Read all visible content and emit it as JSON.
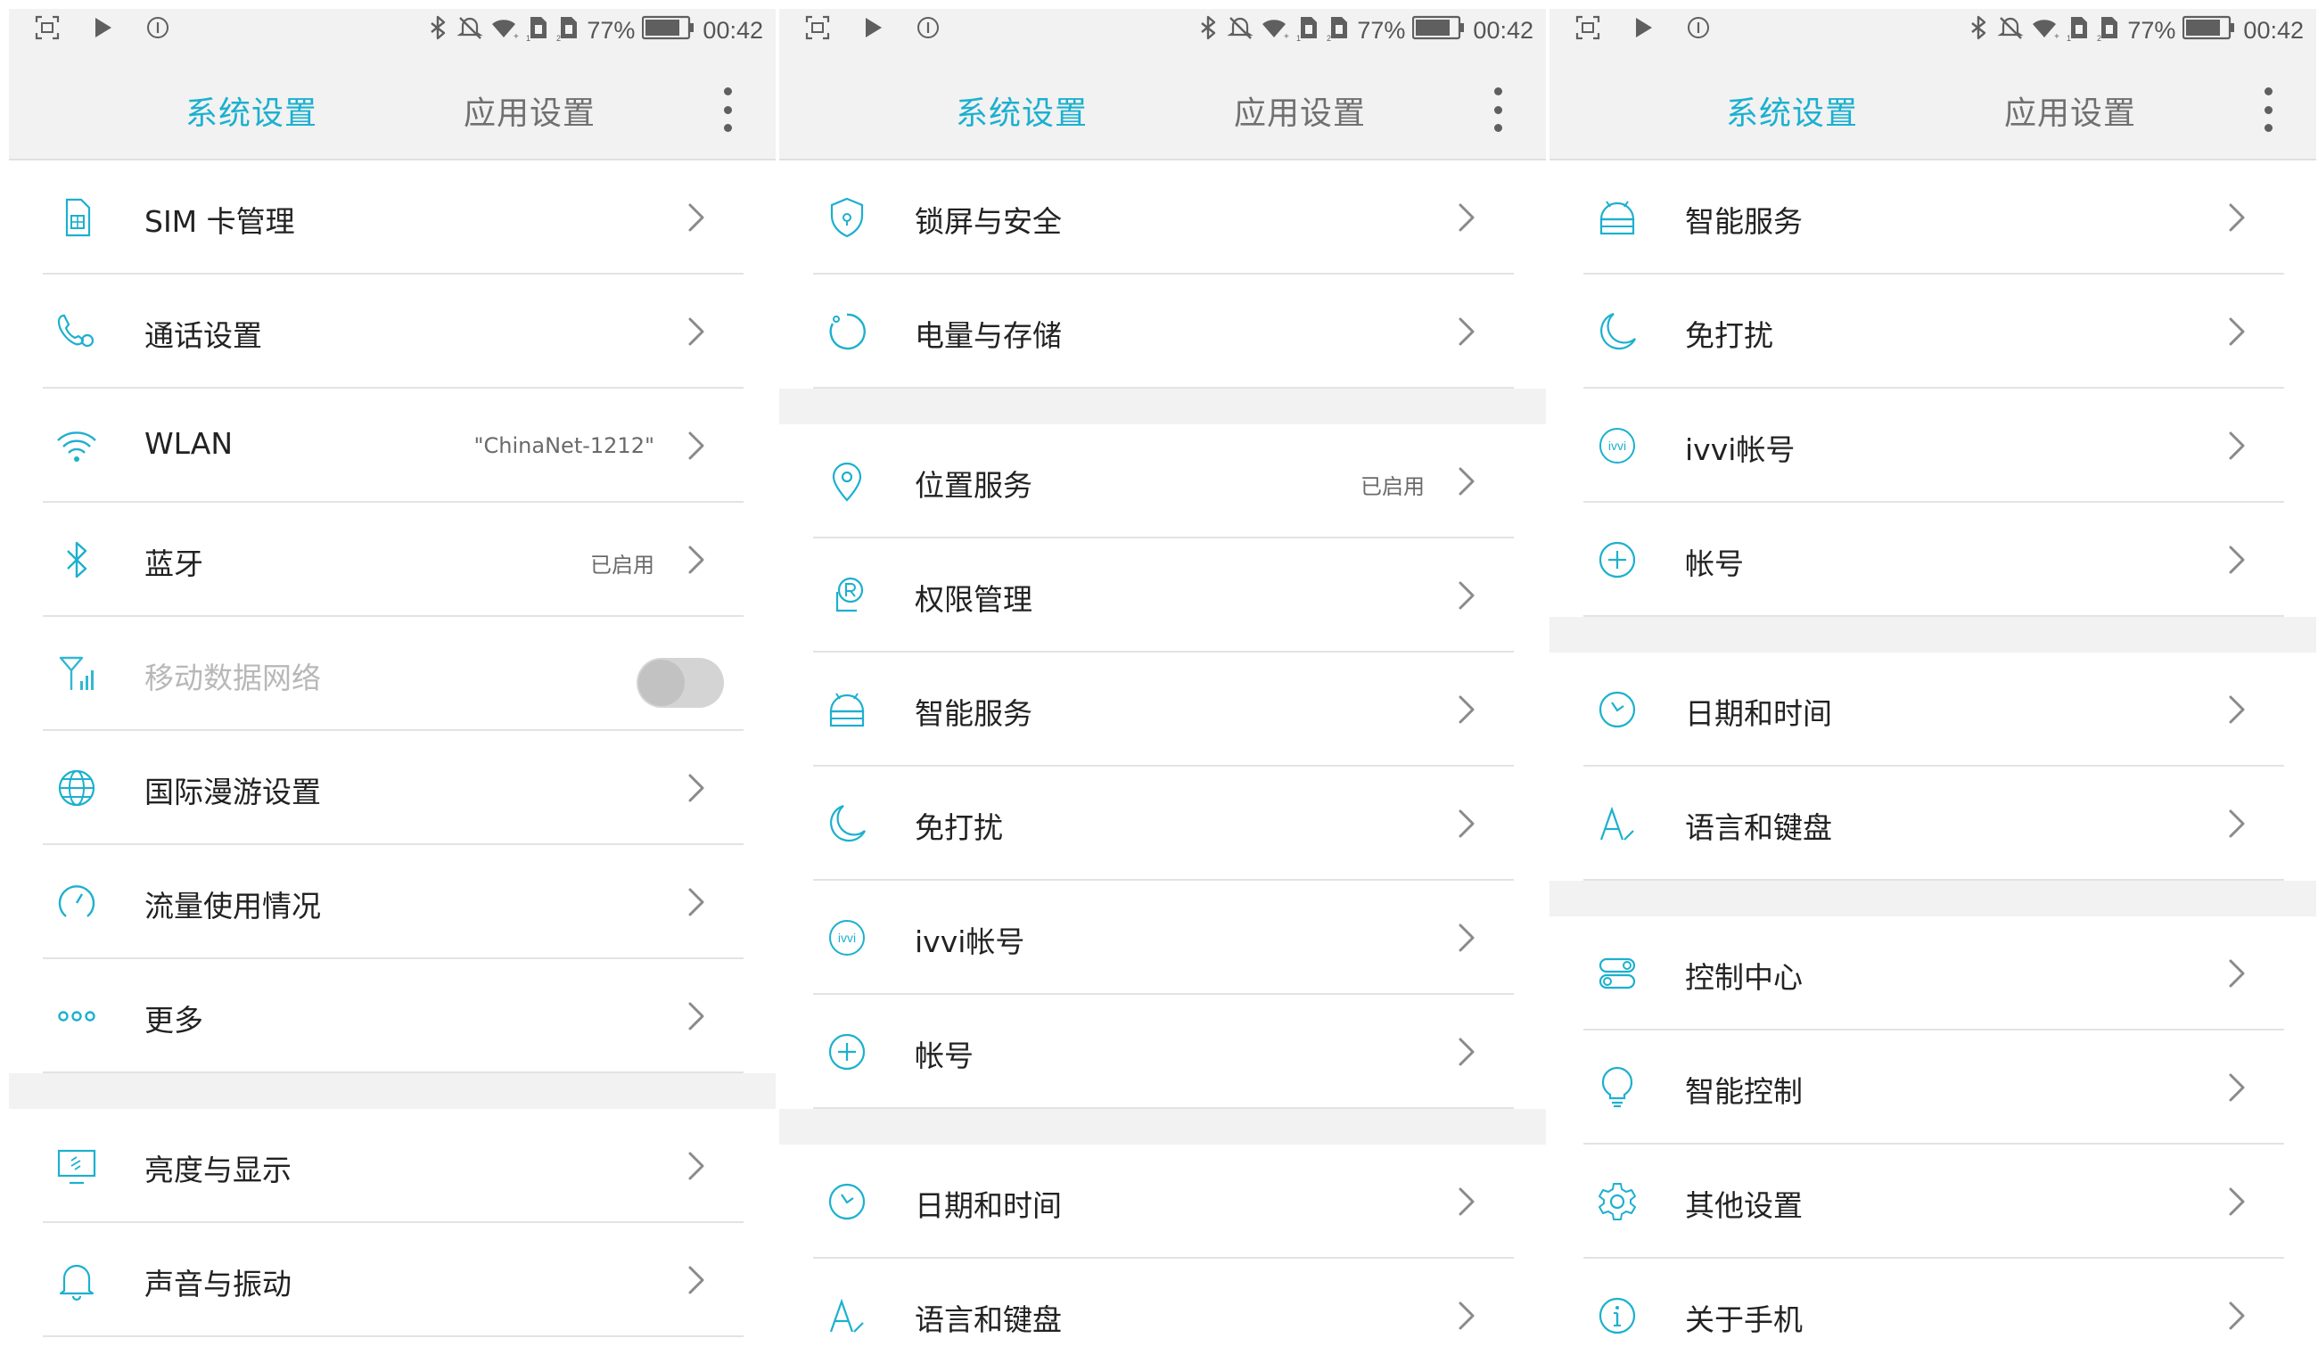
{
  "panels": [
    {
      "status": {
        "battery": "77%",
        "time": "00:42"
      },
      "tabs": {
        "system": "系统设置",
        "apps": "应用设置"
      },
      "sections": [
        [
          {
            "icon": "sim-card-icon",
            "label": "SIM 卡管理"
          },
          {
            "icon": "call-icon",
            "label": "通话设置"
          },
          {
            "icon": "wifi-icon",
            "label": "WLAN",
            "value": "\"ChinaNet-1212\""
          },
          {
            "icon": "bluetooth-icon",
            "label": "蓝牙",
            "value": "已启用"
          },
          {
            "icon": "mobile-data-icon",
            "label": "移动数据网络",
            "toggle": false,
            "disabled": true
          },
          {
            "icon": "globe-icon",
            "label": "国际漫游设置"
          },
          {
            "icon": "data-usage-icon",
            "label": "流量使用情况"
          },
          {
            "icon": "more-icon",
            "label": "更多"
          }
        ],
        [
          {
            "icon": "display-icon",
            "label": "亮度与显示"
          },
          {
            "icon": "bell-icon",
            "label": "声音与振动"
          }
        ]
      ]
    },
    {
      "status": {
        "battery": "77%",
        "time": "00:42"
      },
      "tabs": {
        "system": "系统设置",
        "apps": "应用设置"
      },
      "sections": [
        [
          {
            "icon": "shield-icon",
            "label": "锁屏与安全"
          },
          {
            "icon": "battery-storage-icon",
            "label": "电量与存储"
          }
        ],
        [
          {
            "icon": "location-icon",
            "label": "位置服务",
            "value": "已启用"
          },
          {
            "icon": "permission-icon",
            "label": "权限管理"
          },
          {
            "icon": "smart-service-icon",
            "label": "智能服务"
          },
          {
            "icon": "moon-icon",
            "label": "免打扰"
          },
          {
            "icon": "ivvi-icon",
            "label": "ivvi帐号"
          },
          {
            "icon": "plus-circle-icon",
            "label": "帐号"
          }
        ],
        [
          {
            "icon": "clock-icon",
            "label": "日期和时间"
          },
          {
            "icon": "language-icon",
            "label": "语言和键盘"
          }
        ]
      ]
    },
    {
      "status": {
        "battery": "77%",
        "time": "00:42"
      },
      "tabs": {
        "system": "系统设置",
        "apps": "应用设置"
      },
      "sections": [
        [
          {
            "icon": "smart-service-icon",
            "label": "智能服务"
          },
          {
            "icon": "moon-icon",
            "label": "免打扰"
          },
          {
            "icon": "ivvi-icon",
            "label": "ivvi帐号"
          },
          {
            "icon": "plus-circle-icon",
            "label": "帐号"
          }
        ],
        [
          {
            "icon": "clock-icon",
            "label": "日期和时间"
          },
          {
            "icon": "language-icon",
            "label": "语言和键盘"
          }
        ],
        [
          {
            "icon": "control-center-icon",
            "label": "控制中心"
          },
          {
            "icon": "bulb-icon",
            "label": "智能控制"
          },
          {
            "icon": "gear-icon",
            "label": "其他设置"
          },
          {
            "icon": "info-icon",
            "label": "关于手机"
          }
        ]
      ]
    }
  ],
  "colors": {
    "accent": "#1cb0cf",
    "text": "#222222",
    "secondary": "#707070",
    "divider": "#e3e3e3",
    "band": "#f2f2f2"
  }
}
